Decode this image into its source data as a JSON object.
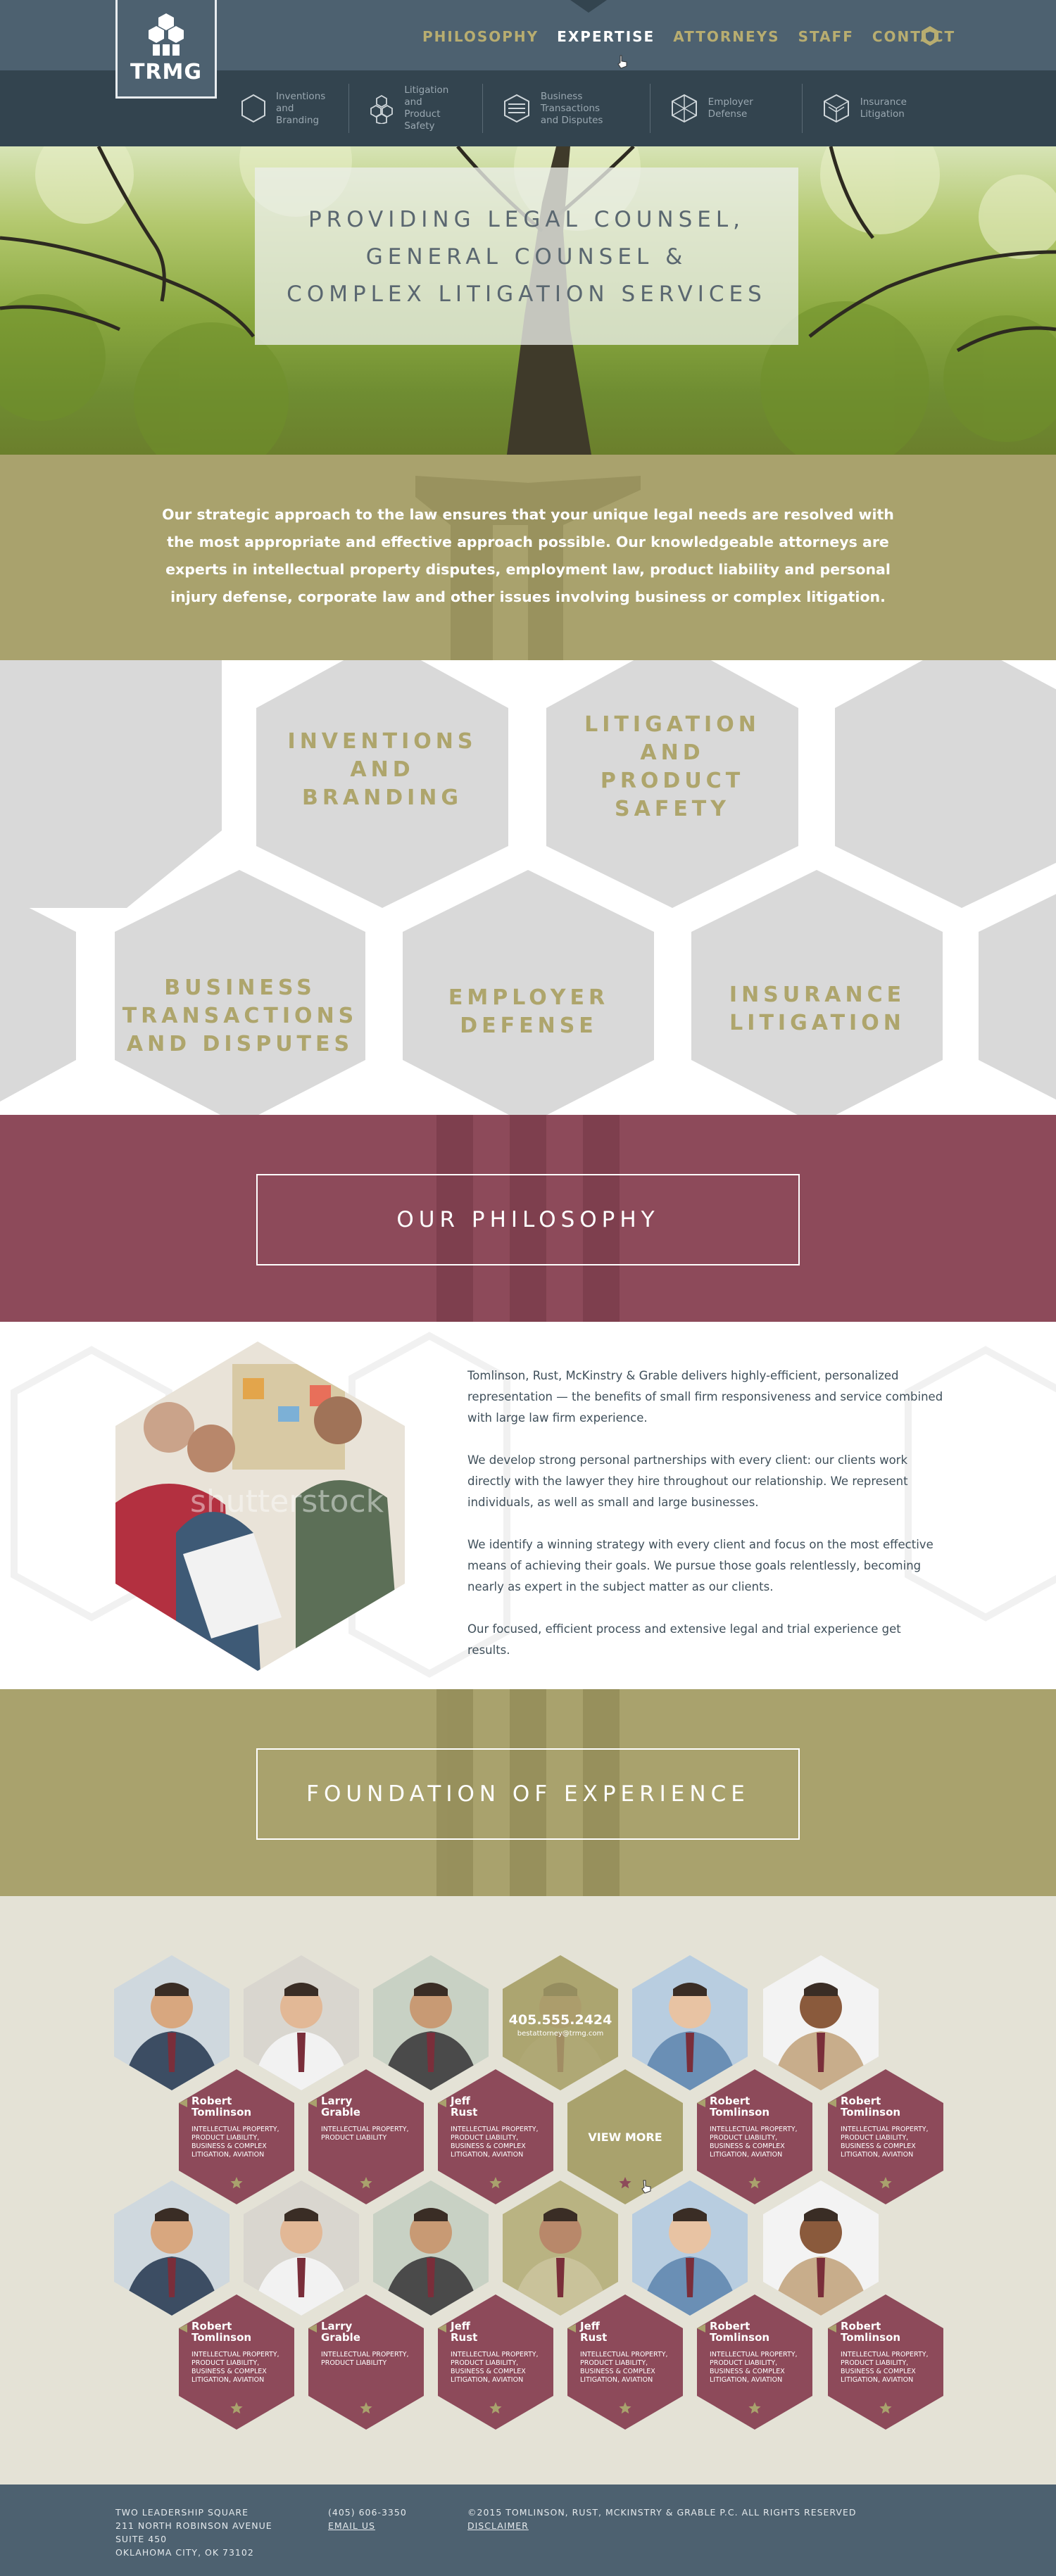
{
  "brand": {
    "logo_text": "TRMG"
  },
  "nav": {
    "items": [
      "PHILOSOPHY",
      "EXPERTISE",
      "ATTORNEYS",
      "STAFF",
      "CONTACT"
    ],
    "active": "EXPERTISE",
    "badge_icon": "shield-hex-icon"
  },
  "subnav": {
    "items": [
      {
        "label": "Inventions\nand Branding",
        "icon": "hexagon-outline-icon"
      },
      {
        "label": "Litigation and\nProduct Safety",
        "icon": "hex-cluster-icon"
      },
      {
        "label": "Business Transactions\nand Disputes",
        "icon": "hex-bars-icon"
      },
      {
        "label": "Employer Defense",
        "icon": "hex-diamond-icon"
      },
      {
        "label": "Insurance\nLitigation",
        "icon": "hex-stack-icon"
      }
    ]
  },
  "hero": {
    "line1": "PROVIDING LEGAL COUNSEL,",
    "line2": "GENERAL COUNSEL &",
    "line3": "COMPLEX LITIGATION SERVICES"
  },
  "intro": {
    "text": "Our strategic approach to the law ensures that your unique legal needs are resolved with the most appropriate and effective approach possible. Our knowledgeable attorneys are experts in intellectual property disputes, employment law, product liability and personal injury defense, corporate law and other issues involving business or complex litigation."
  },
  "practice": {
    "areas": [
      {
        "label": "INVENTIONS\nAND\nBRANDING"
      },
      {
        "label": "LITIGATION\nAND\nPRODUCT\nSAFETY"
      },
      {
        "label": "BUSINESS\nTRANSACTIONS\nAND DISPUTES"
      },
      {
        "label": "EMPLOYER\nDEFENSE"
      },
      {
        "label": "INSURANCE\nLITIGATION"
      }
    ]
  },
  "philosophy": {
    "button": "OUR PHILOSOPHY",
    "paragraphs": [
      "Tomlinson, Rust, McKinstry & Grable delivers highly-efficient, personalized representation — the benefits of small firm responsiveness and service combined with large law firm experience.",
      "We develop strong personal partnerships with every client: our clients work directly with the lawyer they hire throughout our relationship. We represent individuals, as well as small and large businesses.",
      "We identify a winning strategy with every client and focus on the most effective means of achieving their goals. We pursue those goals relentlessly, becoming nearly as expert in the subject matter as our clients.",
      "Our focused, efficient process and extensive legal and trial experience get results."
    ],
    "watermark": "shutterstock"
  },
  "experience": {
    "button": "FOUNDATION OF EXPERIENCE"
  },
  "attorneys": {
    "phone_overlay": "405.555.2424",
    "phone_sub": "bestattorney@trmg.com",
    "view_more": "VIEW MORE",
    "row1": [
      {
        "name": "Robert\nTomlinson",
        "areas": "INTELLECTUAL PROPERTY,\nPRODUCT LIABILITY,\nBUSINESS & COMPLEX\nLITIGATION, AVIATION"
      },
      {
        "name": "Larry\nGrable",
        "areas": "INTELLECTUAL PROPERTY,\nPRODUCT LIABILITY"
      },
      {
        "name": "Jeff\nRust",
        "areas": "INTELLECTUAL PROPERTY,\nPRODUCT LIABILITY,\nBUSINESS & COMPLEX\nLITIGATION, AVIATION"
      },
      {
        "name": "Robert\nTomlinson",
        "areas": "INTELLECTUAL PROPERTY,\nPRODUCT LIABILITY,\nBUSINESS & COMPLEX\nLITIGATION, AVIATION"
      },
      {
        "name": "Robert\nTomlinson",
        "areas": "INTELLECTUAL PROPERTY,\nPRODUCT LIABILITY,\nBUSINESS & COMPLEX\nLITIGATION, AVIATION"
      }
    ],
    "row2": [
      {
        "name": "Robert\nTomlinson",
        "areas": "INTELLECTUAL PROPERTY,\nPRODUCT LIABILITY,\nBUSINESS & COMPLEX\nLITIGATION, AVIATION"
      },
      {
        "name": "Larry\nGrable",
        "areas": "INTELLECTUAL PROPERTY,\nPRODUCT LIABILITY"
      },
      {
        "name": "Jeff\nRust",
        "areas": "INTELLECTUAL PROPERTY,\nPRODUCT LIABILITY,\nBUSINESS & COMPLEX\nLITIGATION, AVIATION"
      },
      {
        "name": "Jeff\nRust",
        "areas": "INTELLECTUAL PROPERTY,\nPRODUCT LIABILITY,\nBUSINESS & COMPLEX\nLITIGATION, AVIATION"
      },
      {
        "name": "Robert\nTomlinson",
        "areas": "INTELLECTUAL PROPERTY,\nPRODUCT LIABILITY,\nBUSINESS & COMPLEX\nLITIGATION, AVIATION"
      },
      {
        "name": "Robert\nTomlinson",
        "areas": "INTELLECTUAL PROPERTY,\nPRODUCT LIABILITY,\nBUSINESS & COMPLEX\nLITIGATION, AVIATION"
      }
    ]
  },
  "footer": {
    "address": "TWO LEADERSHIP SQUARE\n211 NORTH ROBINSON AVENUE\nSUITE 450\nOKLAHOMA CITY, OK 73102",
    "phone": "(405) 606-3350",
    "email": "EMAIL US",
    "copyright": "©2015 TOMLINSON, RUST, MCKINSTRY & GRABLE P.C. ALL RIGHTS RESERVED",
    "disclaimer": "DISCLAIMER"
  },
  "colors": {
    "slate": "#4d6170",
    "slate_dark": "#33444f",
    "olive": "#a9a26d",
    "wine": "#8d4a5a",
    "hex_gray": "#d9d9d9",
    "beige": "#e4e2d6"
  }
}
